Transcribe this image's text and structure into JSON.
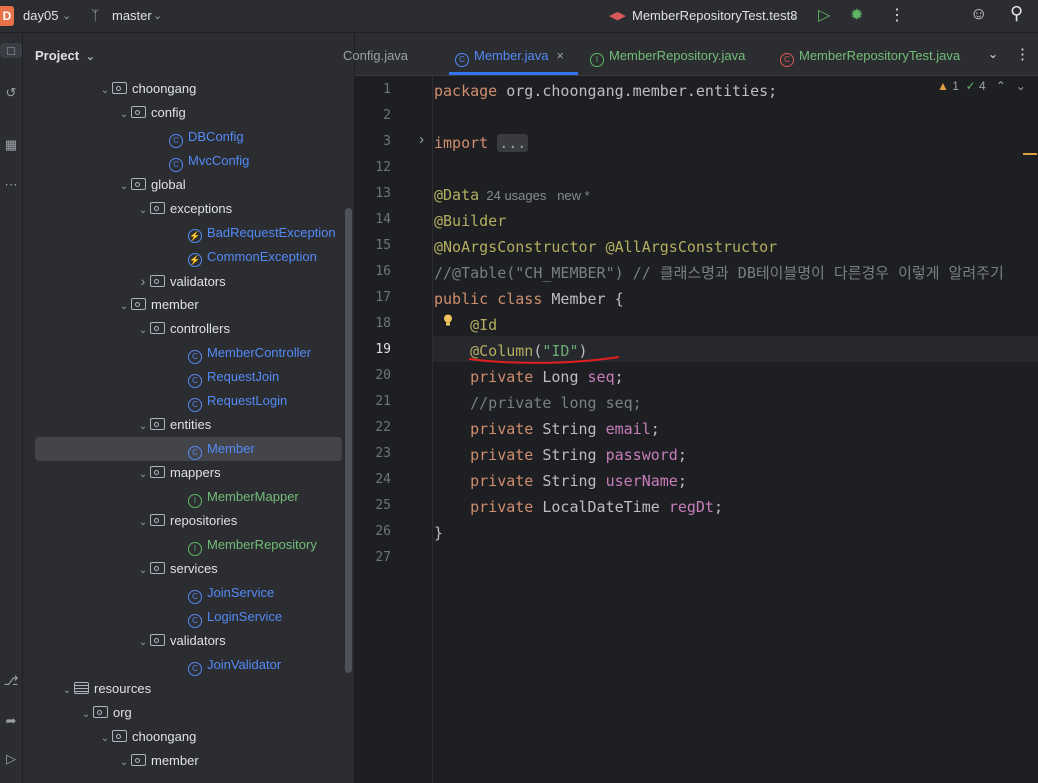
{
  "topbar": {
    "project_badge": "D",
    "project_name": "day05",
    "branch": "master",
    "run_config": "MemberRepositoryTest.test8"
  },
  "project_panel": {
    "title": "Project",
    "tree": [
      {
        "label": "choongang",
        "kind": "folder",
        "depth": 5,
        "open": true
      },
      {
        "label": "config",
        "kind": "folder",
        "depth": 6,
        "open": true
      },
      {
        "label": "DBConfig",
        "kind": "class",
        "depth": 8
      },
      {
        "label": "MvcConfig",
        "kind": "class",
        "depth": 8
      },
      {
        "label": "global",
        "kind": "folder",
        "depth": 6,
        "open": true
      },
      {
        "label": "exceptions",
        "kind": "folder",
        "depth": 7,
        "open": true
      },
      {
        "label": "BadRequestException",
        "kind": "exception",
        "depth": 9
      },
      {
        "label": "CommonException",
        "kind": "exception",
        "depth": 9
      },
      {
        "label": "validators",
        "kind": "folder",
        "depth": 7,
        "open": false
      },
      {
        "label": "member",
        "kind": "folder",
        "depth": 6,
        "open": true
      },
      {
        "label": "controllers",
        "kind": "folder",
        "depth": 7,
        "open": true
      },
      {
        "label": "MemberController",
        "kind": "class",
        "depth": 9
      },
      {
        "label": "RequestJoin",
        "kind": "class",
        "depth": 9
      },
      {
        "label": "RequestLogin",
        "kind": "class",
        "depth": 9
      },
      {
        "label": "entities",
        "kind": "folder",
        "depth": 7,
        "open": true
      },
      {
        "label": "Member",
        "kind": "class",
        "depth": 9,
        "selected": true
      },
      {
        "label": "mappers",
        "kind": "folder",
        "depth": 7,
        "open": true
      },
      {
        "label": "MemberMapper",
        "kind": "interface",
        "depth": 9
      },
      {
        "label": "repositories",
        "kind": "folder",
        "depth": 7,
        "open": true
      },
      {
        "label": "MemberRepository",
        "kind": "interface",
        "depth": 9
      },
      {
        "label": "services",
        "kind": "folder",
        "depth": 7,
        "open": true
      },
      {
        "label": "JoinService",
        "kind": "class",
        "depth": 9
      },
      {
        "label": "LoginService",
        "kind": "class",
        "depth": 9
      },
      {
        "label": "validators",
        "kind": "folder",
        "depth": 7,
        "open": true
      },
      {
        "label": "JoinValidator",
        "kind": "class",
        "depth": 9
      },
      {
        "label": "resources",
        "kind": "resfolder",
        "depth": 3,
        "open": true
      },
      {
        "label": "org",
        "kind": "folder",
        "depth": 4,
        "open": true
      },
      {
        "label": "choongang",
        "kind": "folder",
        "depth": 5,
        "open": true
      },
      {
        "label": "member",
        "kind": "folder",
        "depth": 6,
        "open": true
      }
    ]
  },
  "tabs": [
    {
      "label": "Config.java",
      "visible_text": "Config.java",
      "kind": "class"
    },
    {
      "label": "Member.java",
      "kind": "class",
      "active": true
    },
    {
      "label": "MemberRepository.java",
      "kind": "interface"
    },
    {
      "label": "MemberRepositoryTest.java",
      "kind": "test"
    }
  ],
  "inspections": {
    "warnings": "1",
    "checks": "4"
  },
  "code_lines": [
    {
      "n": "1",
      "html": "<span class='kw'>package</span><span class='plain'> org.choongang.member.entities;</span>"
    },
    {
      "n": "2",
      "html": ""
    },
    {
      "n": "3",
      "html": "<span class='kw'>import</span><span class='plain'> </span><span class='fold'>...</span>"
    },
    {
      "n": "12",
      "html": ""
    },
    {
      "n": "13",
      "html": "<span class='ann'>@Data</span><span class='hint'>  24 usages   new *</span>"
    },
    {
      "n": "14",
      "html": "<span class='ann'>@Builder</span>"
    },
    {
      "n": "15",
      "html": "<span class='ann'>@NoArgsConstructor @AllArgsConstructor</span>"
    },
    {
      "n": "16",
      "html": "<span class='cmt'>//@Table(\"CH_MEMBER\") // 클래스명과 DB테이블명이 다른경우 이렇게 알려주기</span>"
    },
    {
      "n": "17",
      "html": "<span class='kw'>public class</span><span class='plain'> Member {</span>"
    },
    {
      "n": "18",
      "html": "<span class='plain'>    </span><span class='ann'>@Id</span>"
    },
    {
      "n": "19",
      "html": "<span class='plain'>    </span><span class='ann'>@Column</span><span class='plain'>(</span><span class='str'>\"ID\"</span><span class='plain'>)</span>"
    },
    {
      "n": "20",
      "html": "<span class='plain'>    </span><span class='kw'>private</span><span class='plain'> Long </span><span class='fld'>seq</span><span class='plain'>;</span>"
    },
    {
      "n": "21",
      "html": "<span class='cmt'>    //private long seq;</span>"
    },
    {
      "n": "22",
      "html": "<span class='plain'>    </span><span class='kw'>private</span><span class='plain'> String </span><span class='fld'>email</span><span class='plain'>;</span>"
    },
    {
      "n": "23",
      "html": "<span class='plain'>    </span><span class='kw'>private</span><span class='plain'> String </span><span class='fld'>password</span><span class='plain'>;</span>"
    },
    {
      "n": "24",
      "html": "<span class='plain'>    </span><span class='kw'>private</span><span class='plain'> String </span><span class='fld'>userName</span><span class='plain'>;</span>"
    },
    {
      "n": "25",
      "html": "<span class='plain'>    </span><span class='kw'>private</span><span class='plain'> LocalDateTime </span><span class='fld'>regDt</span><span class='plain'>;</span>"
    },
    {
      "n": "26",
      "html": "<span class='plain'>}</span>"
    },
    {
      "n": "27",
      "html": ""
    }
  ],
  "current_line": "19"
}
